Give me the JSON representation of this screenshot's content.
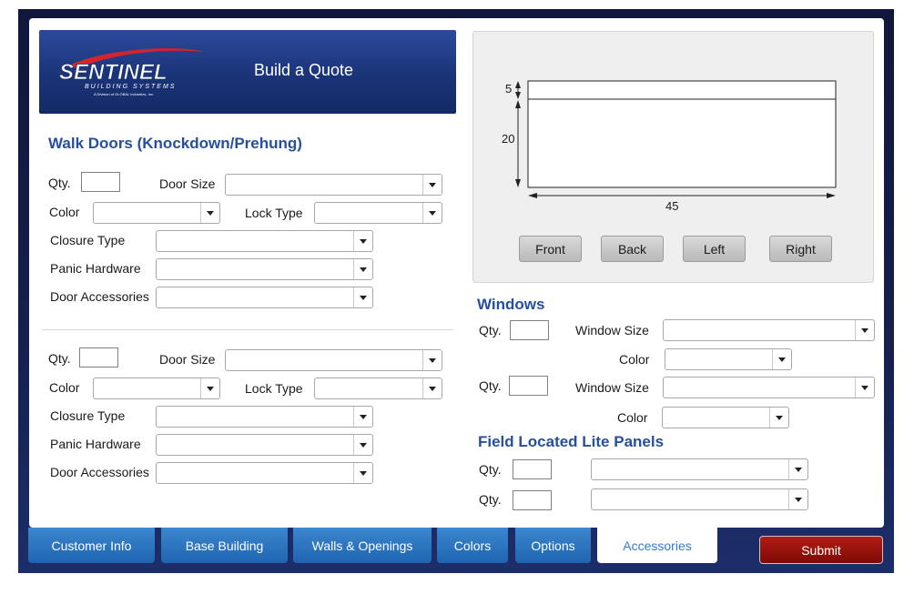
{
  "header": {
    "brand": "SENTINEL",
    "brand_sub": "BUILDING SYSTEMS",
    "brand_tagline": "A Division of GLOBAL Industries, Inc.",
    "title": "Build a Quote"
  },
  "walk_doors": {
    "title": "Walk Doors (Knockdown/Prehung)",
    "groups": [
      {
        "qty_label": "Qty.",
        "qty_value": "",
        "door_size_label": "Door Size",
        "door_size_value": "",
        "color_label": "Color",
        "color_value": "",
        "lock_type_label": "Lock Type",
        "lock_type_value": "",
        "closure_type_label": "Closure Type",
        "closure_type_value": "",
        "panic_hardware_label": "Panic Hardware",
        "panic_hardware_value": "",
        "door_accessories_label": "Door Accessories",
        "door_accessories_value": ""
      },
      {
        "qty_label": "Qty.",
        "qty_value": "",
        "door_size_label": "Door Size",
        "door_size_value": "",
        "color_label": "Color",
        "color_value": "",
        "lock_type_label": "Lock Type",
        "lock_type_value": "",
        "closure_type_label": "Closure Type",
        "closure_type_value": "",
        "panic_hardware_label": "Panic Hardware",
        "panic_hardware_value": "",
        "door_accessories_label": "Door Accessories",
        "door_accessories_value": ""
      }
    ]
  },
  "preview": {
    "dim_top": "5",
    "dim_height": "20",
    "dim_width": "45",
    "buttons": [
      "Front",
      "Back",
      "Left",
      "Right"
    ]
  },
  "windows": {
    "title": "Windows",
    "rows": [
      {
        "qty_label": "Qty.",
        "qty_value": "",
        "size_label": "Window Size",
        "size_value": "",
        "color_label": "Color",
        "color_value": ""
      },
      {
        "qty_label": "Qty.",
        "qty_value": "",
        "size_label": "Window Size",
        "size_value": "",
        "color_label": "Color",
        "color_value": ""
      }
    ]
  },
  "lite_panels": {
    "title": "Field Located Lite Panels",
    "rows": [
      {
        "qty_label": "Qty.",
        "qty_value": "",
        "value": ""
      },
      {
        "qty_label": "Qty.",
        "qty_value": "",
        "value": ""
      }
    ]
  },
  "tabs": [
    "Customer Info",
    "Base Building",
    "Walls & Openings",
    "Colors",
    "Options",
    "Accessories"
  ],
  "active_tab": "Accessories",
  "submit_label": "Submit",
  "colors": {
    "header_blue": "#1b3478",
    "title_blue": "#264f9c",
    "tab_blue": "#2f7bd0",
    "submit_red": "#9a140d"
  }
}
